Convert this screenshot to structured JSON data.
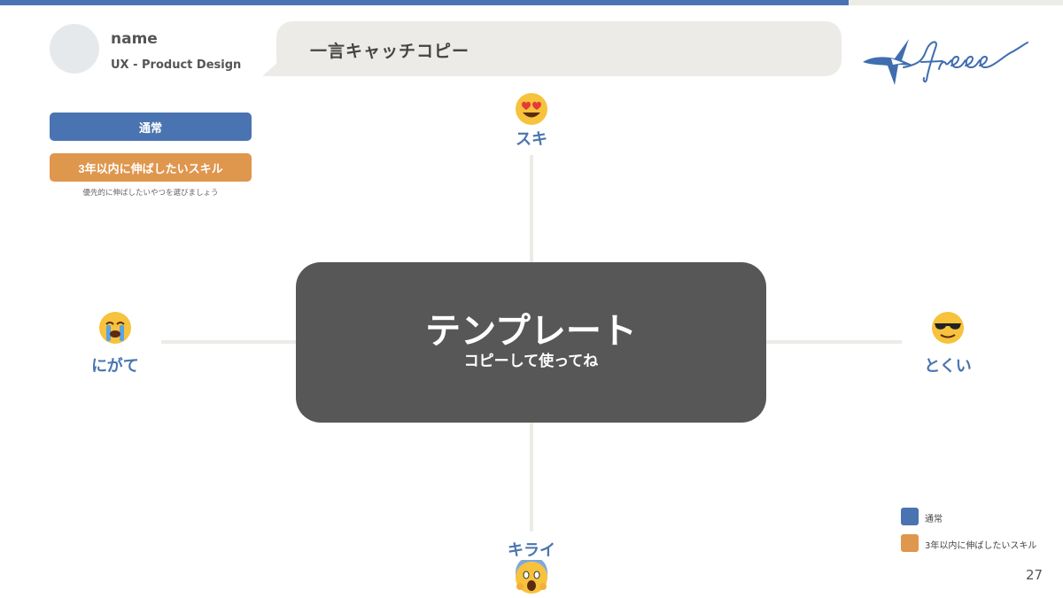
{
  "profile": {
    "name": "name",
    "role": "UX - Product Design"
  },
  "catch_copy": "一言キャッチコピー",
  "logo": {
    "icon": "freee-swallow-logo",
    "wordmark": "freee"
  },
  "buttons": {
    "normal": "通常",
    "grow": "3年以内に伸ばしたいスキル",
    "note": "優先的に伸ばしたいやつを選びましょう"
  },
  "axes": {
    "top": {
      "label": "スキ",
      "icon": "heart-eyes-emoji"
    },
    "bottom": {
      "label": "キライ",
      "icon": "screaming-face-emoji"
    },
    "left": {
      "label": "にがて",
      "icon": "crying-face-emoji"
    },
    "right": {
      "label": "とくい",
      "icon": "sunglasses-face-emoji"
    }
  },
  "center": {
    "title": "テンプレート",
    "subtitle": "コピーして使ってね"
  },
  "legend": [
    {
      "label": "通常",
      "color": "#4a74b1"
    },
    {
      "label": "3年以内に伸ばしたいスキル",
      "color": "#df964d"
    }
  ],
  "page_number": "27",
  "colors": {
    "accent_blue": "#4a74b1",
    "accent_orange": "#df964d",
    "center_box": "#575757"
  }
}
